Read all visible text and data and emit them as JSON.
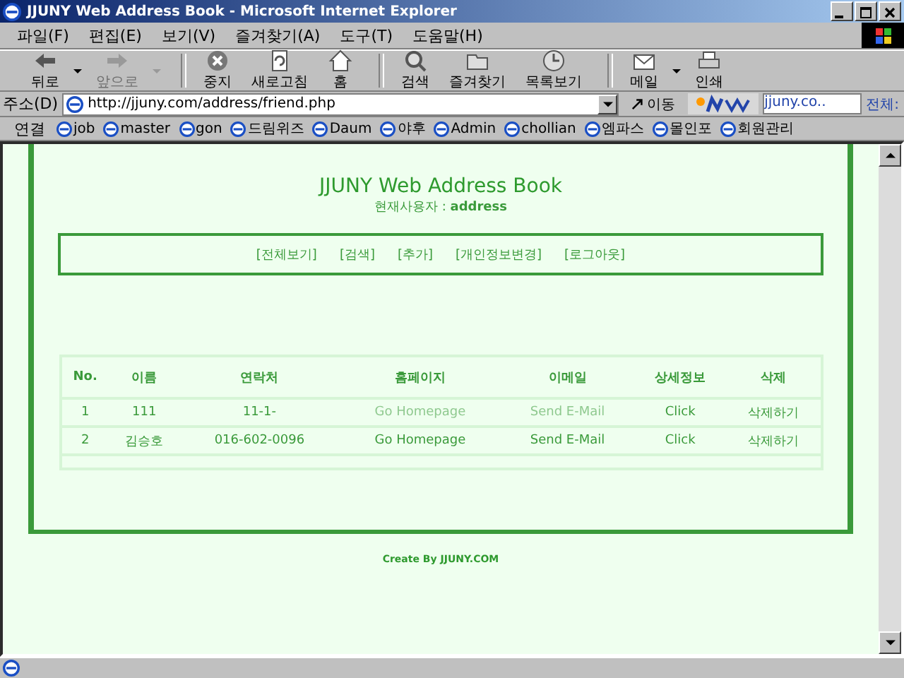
{
  "window": {
    "title": "JJUNY Web Address Book - Microsoft Internet Explorer"
  },
  "menu": [
    "파일(F)",
    "편집(E)",
    "보기(V)",
    "즐겨찾기(A)",
    "도구(T)",
    "도움말(H)"
  ],
  "toolbar": [
    {
      "kind": "back",
      "label": "뒤로",
      "disabled": false
    },
    {
      "kind": "forward",
      "label": "앞으로",
      "disabled": true
    },
    {
      "kind": "stop",
      "label": "중지",
      "disabled": false
    },
    {
      "kind": "refresh",
      "label": "새로고침",
      "disabled": false
    },
    {
      "kind": "home",
      "label": "홈",
      "disabled": false
    },
    {
      "kind": "search",
      "label": "검색",
      "disabled": false
    },
    {
      "kind": "favorites",
      "label": "즐겨찾기",
      "disabled": false
    },
    {
      "kind": "history",
      "label": "목록보기",
      "disabled": false
    },
    {
      "kind": "mail",
      "label": "메일",
      "disabled": false
    },
    {
      "kind": "print",
      "label": "인쇄",
      "disabled": false
    }
  ],
  "address_bar": {
    "label": "주소(D)",
    "value": "http://jjuny.com/address/friend.php",
    "go": "이동",
    "search_value": "jjuny.co..",
    "search_label": "전체:"
  },
  "links_bar": {
    "label": "연결",
    "links": [
      "job",
      "master",
      "gon",
      "드림위즈",
      "Daum",
      "야후",
      "Admin",
      "chollian",
      "엠파스",
      "몰인포",
      "회원관리"
    ]
  },
  "page": {
    "title": "JJUNY Web Address Book",
    "user_label": "현재사용자 :",
    "user": "address",
    "nav": [
      "[전체보기]",
      "[검색]",
      "[추가]",
      "[개인정보변경]",
      "[로그아웃]"
    ],
    "table": {
      "columns": [
        "No.",
        "이름",
        "연락처",
        "홈페이지",
        "이메일",
        "상세정보",
        "삭제"
      ],
      "rows": [
        {
          "no": "1",
          "name": "111",
          "phone": "11-1-",
          "homepage": {
            "label": "Go Homepage",
            "disabled": true
          },
          "email": {
            "label": "Send E-Mail",
            "disabled": true
          },
          "detail": "Click",
          "delete": "삭제하기"
        },
        {
          "no": "2",
          "name": "김승호",
          "phone": "016-602-0096",
          "homepage": {
            "label": "Go Homepage",
            "disabled": false
          },
          "email": {
            "label": "Send E-Mail",
            "disabled": false
          },
          "detail": "Click",
          "delete": "삭제하기"
        }
      ]
    },
    "footer": "Create By JJUNY.COM"
  }
}
